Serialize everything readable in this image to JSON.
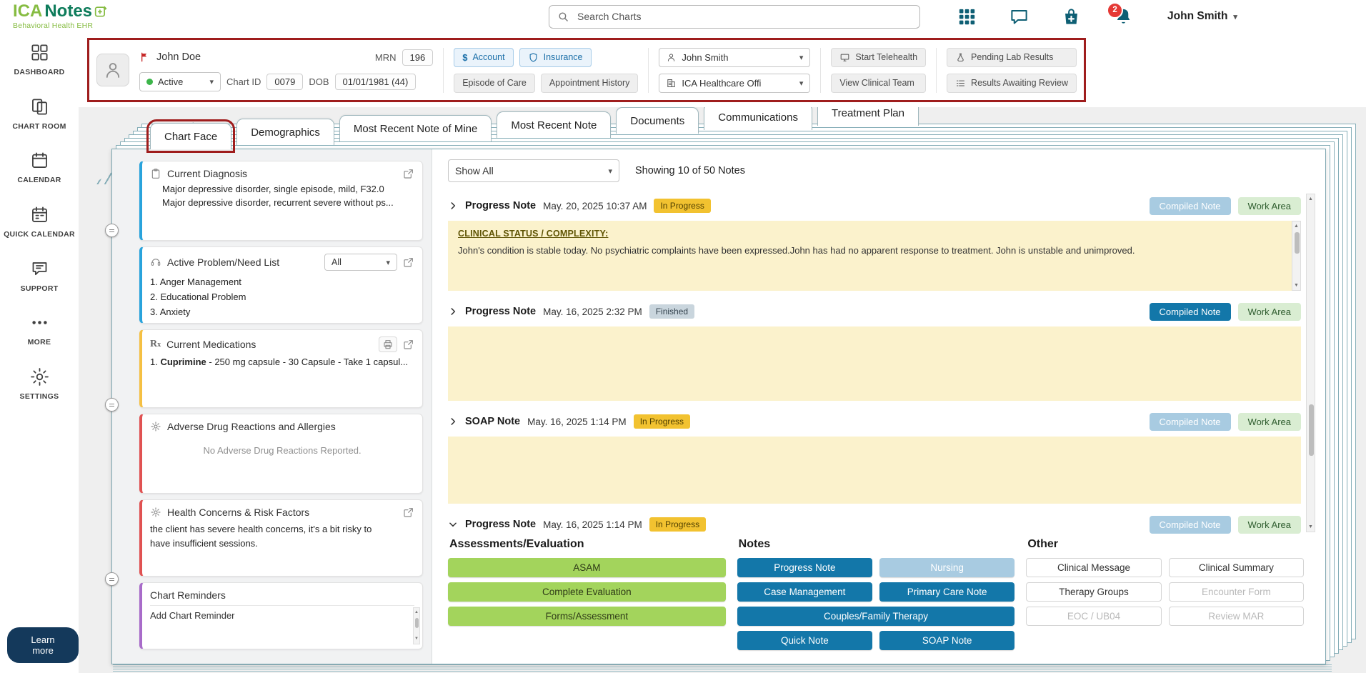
{
  "colors": {
    "brand_green": "#86BC42",
    "brand_dark_green": "#0E7C5B",
    "teal_edge": "#86AEB8",
    "accent_blue": "#1377A9",
    "accent_blue_light": "#A8CBE1",
    "annotation_red": "#9F1D1D",
    "note_yellow": "#FBF2CC",
    "badge_yellow": "#F2C230",
    "badge_gray": "#C9D5DD",
    "work_area_green": "#D9EDD2",
    "action_green": "#A3D45C",
    "card_blue": "#29A3DC",
    "card_yellow": "#F5C043",
    "card_red": "#E05252",
    "card_purple": "#A86BC9",
    "active_dot_green": "#3CB54A",
    "notification_red": "#E53935",
    "learn_more_navy": "#14395B"
  },
  "header": {
    "logo_primary": "ICA",
    "logo_secondary": "Notes",
    "tagline": "Behavioral Health EHR",
    "search_placeholder": "Search Charts",
    "notification_count": "2",
    "user_name": "John Smith"
  },
  "sidebar": {
    "items": [
      {
        "label": "DASHBOARD"
      },
      {
        "label": "CHART ROOM"
      },
      {
        "label": "CALENDAR"
      },
      {
        "label": "QUICK CALENDAR"
      },
      {
        "label": "SUPPORT"
      },
      {
        "label": "MORE"
      },
      {
        "label": "SETTINGS"
      }
    ],
    "learn_more_label": "Learn more"
  },
  "patient_bar": {
    "name": "John Doe",
    "mrn_label": "MRN",
    "mrn_value": "196",
    "status_value": "Active",
    "chart_id_label": "Chart ID",
    "chart_id_value": "0079",
    "dob_label": "DOB",
    "dob_value": "01/01/1981 (44)",
    "account_label": "Account",
    "insurance_label": "Insurance",
    "episode_label": "Episode of Care",
    "appt_history_label": "Appointment History",
    "provider_value": "John Smith",
    "office_value": "ICA Healthcare Offi",
    "start_telehealth_label": "Start Telehealth",
    "view_clinical_team_label": "View Clinical Team",
    "pending_labs_label": "Pending Lab Results",
    "results_review_label": "Results Awaiting Review"
  },
  "tabs": [
    {
      "label": "Chart Face",
      "active": true
    },
    {
      "label": "Demographics",
      "active": false
    },
    {
      "label": "Most Recent Note of Mine",
      "active": false
    },
    {
      "label": "Most Recent Note",
      "active": false
    },
    {
      "label": "Documents",
      "active": false
    },
    {
      "label": "Communications",
      "active": false
    },
    {
      "label": "Treatment Plan",
      "active": false
    }
  ],
  "cards": {
    "diagnosis": {
      "title": "Current Diagnosis",
      "items": [
        "Major depressive disorder, single episode, mild, F32.0",
        "Major depressive disorder, recurrent severe without ps..."
      ]
    },
    "problems": {
      "title": "Active Problem/Need List",
      "filter_value": "All",
      "items": [
        "1. Anger Management",
        "2. Educational Problem",
        "3. Anxiety"
      ]
    },
    "medications": {
      "title": "Current Medications",
      "item_prefix": "1. ",
      "item_name": "Cuprimine",
      "item_rest": " - 250 mg capsule - 30 Capsule - Take 1 capsul..."
    },
    "allergies": {
      "title": "Adverse Drug Reactions and Allergies",
      "empty_text": "No Adverse Drug Reactions Reported."
    },
    "health_concerns": {
      "title": "Health Concerns & Risk Factors",
      "text": "the client has severe health concerns, it's a bit risky to have insufficient sessions."
    },
    "reminders": {
      "title": "Chart Reminders",
      "text": "Add Chart Reminder"
    }
  },
  "notes_panel": {
    "filter_value": "Show All",
    "count_text": "Showing 10 of 50 Notes",
    "compiled_label": "Compiled Note",
    "work_area_label": "Work Area",
    "notes": [
      {
        "title": "Progress Note",
        "date": "May. 20, 2025 10:37 AM",
        "status": "In Progress",
        "content_heading": "CLINICAL STATUS / COMPLEXITY:",
        "content_text": "John's condition is stable today. No psychiatric complaints have been expressed.John has had no apparent response to treatment. John is unstable and unimproved."
      },
      {
        "title": "Progress Note",
        "date": "May. 16, 2025 2:32 PM",
        "status": "Finished"
      },
      {
        "title": "SOAP Note",
        "date": "May. 16, 2025 1:14 PM",
        "status": "In Progress"
      },
      {
        "title": "Progress Note",
        "date": "May. 16, 2025 1:14 PM",
        "status": "In Progress"
      }
    ]
  },
  "actions": {
    "assessments": {
      "title": "Assessments/Evaluation",
      "buttons": [
        "ASAM",
        "Complete Evaluation",
        "Forms/Assessment"
      ]
    },
    "notes": {
      "title": "Notes",
      "buttons": [
        "Progress Note",
        "Nursing",
        "Case Management",
        "Primary Care Note",
        "Couples/Family Therapy",
        "Quick Note",
        "SOAP Note"
      ]
    },
    "other": {
      "title": "Other",
      "buttons": [
        "Clinical Message",
        "Clinical Summary",
        "Therapy Groups",
        "Encounter Form",
        "EOC / UB04",
        "Review MAR"
      ]
    }
  }
}
